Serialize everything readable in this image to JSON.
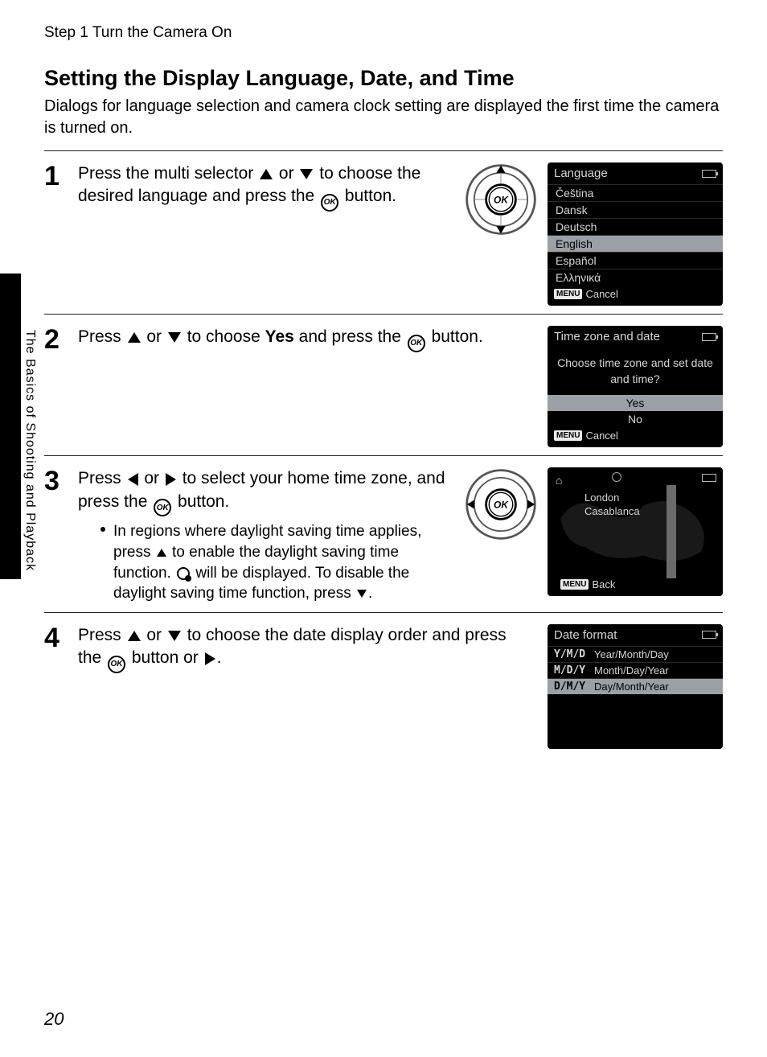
{
  "running_head": "Step 1 Turn the Camera On",
  "section_title": "Setting the Display Language, Date, and Time",
  "intro": "Dialogs for language selection and camera clock setting are displayed the first time the camera is turned on.",
  "side_text": "The Basics of Shooting and Playback",
  "page_number": "20",
  "steps": {
    "s1": {
      "num": "1",
      "text_a": "Press the multi selector ",
      "text_b": " or ",
      "text_c": " to choose the desired language and press the ",
      "text_d": " button.",
      "ok_label": "OK"
    },
    "s2": {
      "num": "2",
      "text_a": "Press ",
      "text_b": " or ",
      "text_c": " to choose ",
      "text_yes": "Yes",
      "text_d": " and press the ",
      "text_e": " button.",
      "ok_label": "OK"
    },
    "s3": {
      "num": "3",
      "text_a": "Press ",
      "text_b": " or ",
      "text_c": " to select your home time zone, and press the ",
      "text_d": " button.",
      "ok_label": "OK",
      "bullet_a": "In regions where daylight saving time applies, press ",
      "bullet_b": " to enable the daylight saving time function. ",
      "bullet_c": " will be displayed. To disable the daylight saving time function, press ",
      "bullet_d": "."
    },
    "s4": {
      "num": "4",
      "text_a": "Press ",
      "text_b": " or ",
      "text_c": " to choose the date display order and press the ",
      "text_d": " button or ",
      "text_e": ".",
      "ok_label": "OK"
    }
  },
  "lcd": {
    "lang": {
      "title": "Language",
      "items": [
        "Čeština",
        "Dansk",
        "Deutsch",
        "English",
        "Español",
        "Ελληνικά"
      ],
      "selected_index": 3,
      "menu": "MENU",
      "cancel": "Cancel"
    },
    "tz": {
      "title": "Time zone and date",
      "prompt": "Choose time zone and set date and time?",
      "yes": "Yes",
      "no": "No",
      "menu": "MENU",
      "cancel": "Cancel"
    },
    "map": {
      "city1": "London",
      "city2": "Casablanca",
      "menu": "MENU",
      "back": "Back"
    },
    "fmt": {
      "title": "Date format",
      "rows": [
        {
          "code": "Y/M/D",
          "label": "Year/Month/Day"
        },
        {
          "code": "M/D/Y",
          "label": "Month/Day/Year"
        },
        {
          "code": "D/M/Y",
          "label": "Day/Month/Year"
        }
      ],
      "selected_index": 2
    }
  }
}
